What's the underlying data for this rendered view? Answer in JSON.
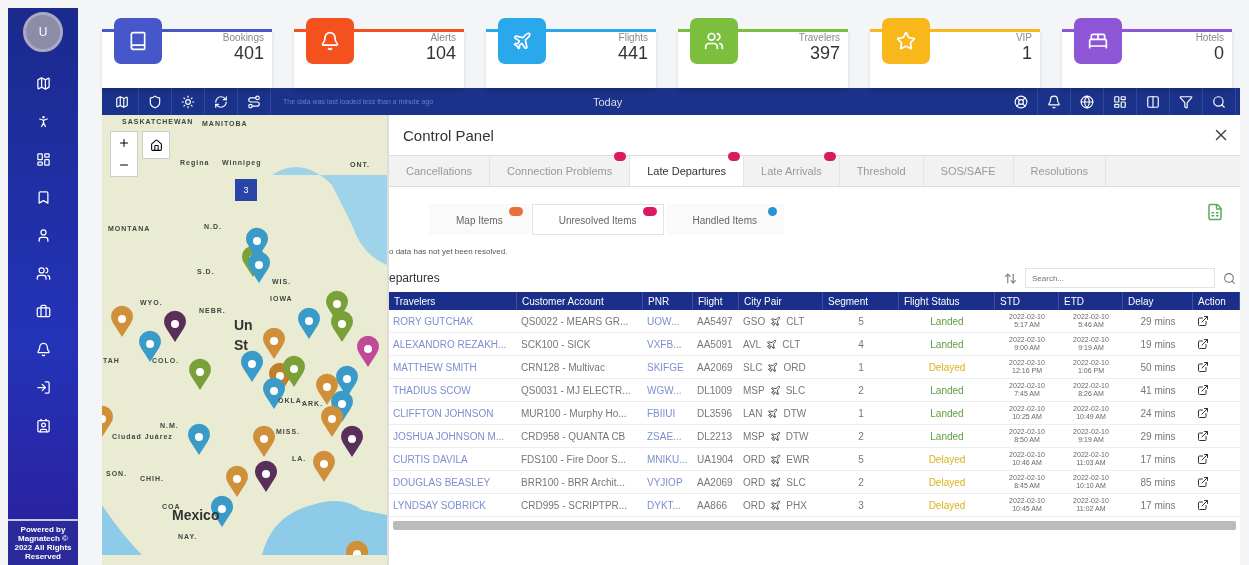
{
  "sidebar": {
    "avatar": "U",
    "items": [
      {
        "kind": "map"
      },
      {
        "kind": "run"
      },
      {
        "kind": "dashboard"
      },
      {
        "kind": "bookmark"
      },
      {
        "kind": "user"
      },
      {
        "kind": "users"
      },
      {
        "kind": "briefcase"
      },
      {
        "kind": "bell"
      },
      {
        "kind": "login"
      },
      {
        "kind": "contact"
      }
    ],
    "footer": "Powered by Magnatech © 2022 All Rights Reserved"
  },
  "stats": [
    {
      "label": "Bookings",
      "value": "401",
      "kind": "book",
      "color": "#4657c9"
    },
    {
      "label": "Alerts",
      "value": "104",
      "kind": "bell",
      "color": "#f4511e"
    },
    {
      "label": "Flights",
      "value": "441",
      "kind": "plane",
      "color": "#2aa8ec"
    },
    {
      "label": "Travelers",
      "value": "397",
      "kind": "users",
      "color": "#7cbf3f"
    },
    {
      "label": "VIP",
      "value": "1",
      "kind": "star",
      "color": "#f8b81c"
    },
    {
      "label": "Hotels",
      "value": "0",
      "kind": "bed",
      "color": "#8c56d6"
    }
  ],
  "toolbar": {
    "left": [
      {
        "kind": "map"
      },
      {
        "kind": "shield"
      },
      {
        "kind": "sun"
      },
      {
        "kind": "refresh"
      },
      {
        "kind": "route"
      }
    ],
    "note": "The data was last loaded less than a minute ago",
    "title": "Today",
    "right": [
      {
        "kind": "lifebuoy"
      },
      {
        "kind": "bell"
      },
      {
        "kind": "globe"
      },
      {
        "kind": "dashboard"
      },
      {
        "kind": "columns"
      },
      {
        "kind": "filter"
      },
      {
        "kind": "search"
      }
    ]
  },
  "map": {
    "cluster": "3",
    "labels": [
      "SASKATCHEWAN",
      "MANITOBA",
      "Regina",
      "Winnipeg",
      "ONT.",
      "MONTANA",
      "N.D.",
      "S.D.",
      "WYO.",
      "NEBR.",
      "WIS.",
      "IOWA",
      "Un",
      "St",
      "TAH",
      "COLO.",
      "OKLA.",
      "ARK.",
      "N.M.",
      "Ciudad Juárez",
      "MISS.",
      "LA.",
      "SON.",
      "CHIH.",
      "COA",
      "Mexico",
      "NAY."
    ]
  },
  "panel": {
    "title": "Control Panel",
    "tabs": [
      {
        "label": "Cancellations",
        "selected": false,
        "badge": false
      },
      {
        "label": "Connection Problems",
        "selected": false,
        "badge": true
      },
      {
        "label": "Late Departures",
        "selected": true,
        "badge": true
      },
      {
        "label": "Late Arrivals",
        "selected": false,
        "badge": true
      },
      {
        "label": "Threshold",
        "selected": false,
        "badge": false
      },
      {
        "label": "SOS/SAFE",
        "selected": false,
        "badge": false
      },
      {
        "label": "Resolutions",
        "selected": false,
        "badge": false
      }
    ],
    "subtabs": [
      {
        "label": "Map Items",
        "selected": false,
        "color": "#e8703a"
      },
      {
        "label": "Unresolved Items",
        "selected": true,
        "color": "#d81b60"
      },
      {
        "label": "Handled Items",
        "selected": false,
        "color": "#2a93d5"
      }
    ],
    "message": "o data has not yet been resolved.",
    "heading": "epartures",
    "search": {
      "placeholder": "Search..."
    },
    "table": {
      "columns": [
        "Travelers",
        "Customer Account",
        "PNR",
        "Flight",
        "City Pair",
        "Segment",
        "Flight Status",
        "STD",
        "ETD",
        "Delay",
        "Action"
      ],
      "rows": [
        {
          "traveler": "RORY GUTCHAK",
          "account": "QS0022 - MEARS GR...",
          "pnr": "UOW...",
          "flight": "AA5497",
          "from": "GSO",
          "to": "CLT",
          "segment": "5",
          "status": {
            "text": "Landed",
            "kind": "landed"
          },
          "std": [
            "2022-02-10",
            "5:17 AM"
          ],
          "etd": [
            "2022-02-10",
            "5:46 AM"
          ],
          "delay": "29 mins"
        },
        {
          "traveler": "ALEXANDRO REZAKH...",
          "account": "SCK100 - SICK",
          "pnr": "VXFB...",
          "flight": "AA5091",
          "from": "AVL",
          "to": "CLT",
          "segment": "4",
          "status": {
            "text": "Landed",
            "kind": "landed"
          },
          "std": [
            "2022-02-10",
            "9:00 AM"
          ],
          "etd": [
            "2022-02-10",
            "9:19 AM"
          ],
          "delay": "19 mins"
        },
        {
          "traveler": "MATTHEW SMITH",
          "account": "CRN128 - Multivac",
          "pnr": "SKIFGE",
          "flight": "AA2069",
          "from": "SLC",
          "to": "ORD",
          "segment": "1",
          "status": {
            "text": "Delayed",
            "kind": "delayed"
          },
          "std": [
            "2022-02-10",
            "12:16 PM"
          ],
          "etd": [
            "2022-02-10",
            "1:06 PM"
          ],
          "delay": "50 mins"
        },
        {
          "traveler": "THADIUS SCOW",
          "account": "QS0031 - MJ ELECTR...",
          "pnr": "WGW...",
          "flight": "DL1009",
          "from": "MSP",
          "to": "SLC",
          "segment": "2",
          "status": {
            "text": "Landed",
            "kind": "landed"
          },
          "std": [
            "2022-02-10",
            "7:45 AM"
          ],
          "etd": [
            "2022-02-10",
            "8:26 AM"
          ],
          "delay": "41 mins"
        },
        {
          "traveler": "CLIFFTON JOHNSON",
          "account": "MUR100 - Murphy Ho...",
          "pnr": "FBIIUI",
          "flight": "DL3596",
          "from": "LAN",
          "to": "DTW",
          "segment": "1",
          "status": {
            "text": "Landed",
            "kind": "landed"
          },
          "std": [
            "2022-02-10",
            "10:25 AM"
          ],
          "etd": [
            "2022-02-10",
            "10:49 AM"
          ],
          "delay": "24 mins"
        },
        {
          "traveler": "JOSHUA JOHNSON M...",
          "account": "CRD958 - QUANTA CB",
          "pnr": "ZSAE...",
          "flight": "DL2213",
          "from": "MSP",
          "to": "DTW",
          "segment": "2",
          "status": {
            "text": "Landed",
            "kind": "landed"
          },
          "std": [
            "2022-02-10",
            "8:50 AM"
          ],
          "etd": [
            "2022-02-10",
            "9:19 AM"
          ],
          "delay": "29 mins"
        },
        {
          "traveler": "CURTIS DAVILA",
          "account": "FDS100 - Fire Door S...",
          "pnr": "MNIKU...",
          "flight": "UA1904",
          "from": "ORD",
          "to": "EWR",
          "segment": "5",
          "status": {
            "text": "Delayed",
            "kind": "delayed"
          },
          "std": [
            "2022-02-10",
            "10:46 AM"
          ],
          "etd": [
            "2022-02-10",
            "11:03 AM"
          ],
          "delay": "17 mins"
        },
        {
          "traveler": "DOUGLAS BEASLEY",
          "account": "BRR100 - BRR Archit...",
          "pnr": "VYJIOP",
          "flight": "AA2069",
          "from": "ORD",
          "to": "SLC",
          "segment": "2",
          "status": {
            "text": "Delayed",
            "kind": "delayed"
          },
          "std": [
            "2022-02-10",
            "8:45 AM"
          ],
          "etd": [
            "2022-02-10",
            "10:10 AM"
          ],
          "delay": "85 mins"
        },
        {
          "traveler": "LYNDSAY SOBRICK",
          "account": "CRD995 - SCRIPTPR...",
          "pnr": "DYKT...",
          "flight": "AA866",
          "from": "ORD",
          "to": "PHX",
          "segment": "3",
          "status": {
            "text": "Delayed",
            "kind": "delayed"
          },
          "std": [
            "2022-02-10",
            "10:45 AM"
          ],
          "etd": [
            "2022-02-10",
            "11:02 AM"
          ],
          "delay": "17 mins"
        }
      ]
    }
  }
}
